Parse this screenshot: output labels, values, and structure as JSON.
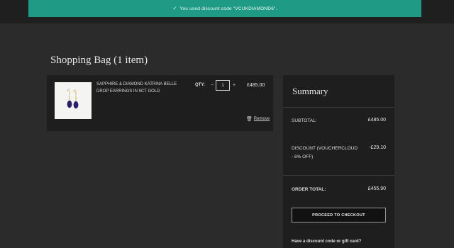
{
  "banner": {
    "check_icon": "check-icon",
    "message": "You used discount code \"VCUKDIAMOND6\"."
  },
  "page": {
    "title": "Shopping Bag (1 item)"
  },
  "cart": {
    "items": [
      {
        "name": "SAPPHIRE & DIAMOND KATRINA BELLE DROP EARRINGS IN 9CT GOLD",
        "qty_label": "QTY:",
        "qty_minus": "−",
        "qty_value": "1",
        "qty_plus": "+",
        "price": "£485.00",
        "remove_label": "Remove",
        "remove_icon": "trash-icon"
      }
    ]
  },
  "summary": {
    "title": "Summary",
    "subtotal_label": "SUBTOTAL:",
    "subtotal_value": "£485.00",
    "discount_label": "DISCOUNT (VOUCHERCLOUD - 6% OFF)",
    "discount_value": "-£29.10",
    "total_label": "ORDER TOTAL:",
    "total_value": "£455.90",
    "checkout_label": "PROCEED TO CHECKOUT",
    "code_link": "Have a discount code or gift card?"
  },
  "colors": {
    "banner_bg": "#1f9a84",
    "page_bg": "#2b2b2b",
    "panel_bg": "#1e1e1e",
    "gem": "#2a1f6b",
    "gold": "#c9a23a"
  }
}
